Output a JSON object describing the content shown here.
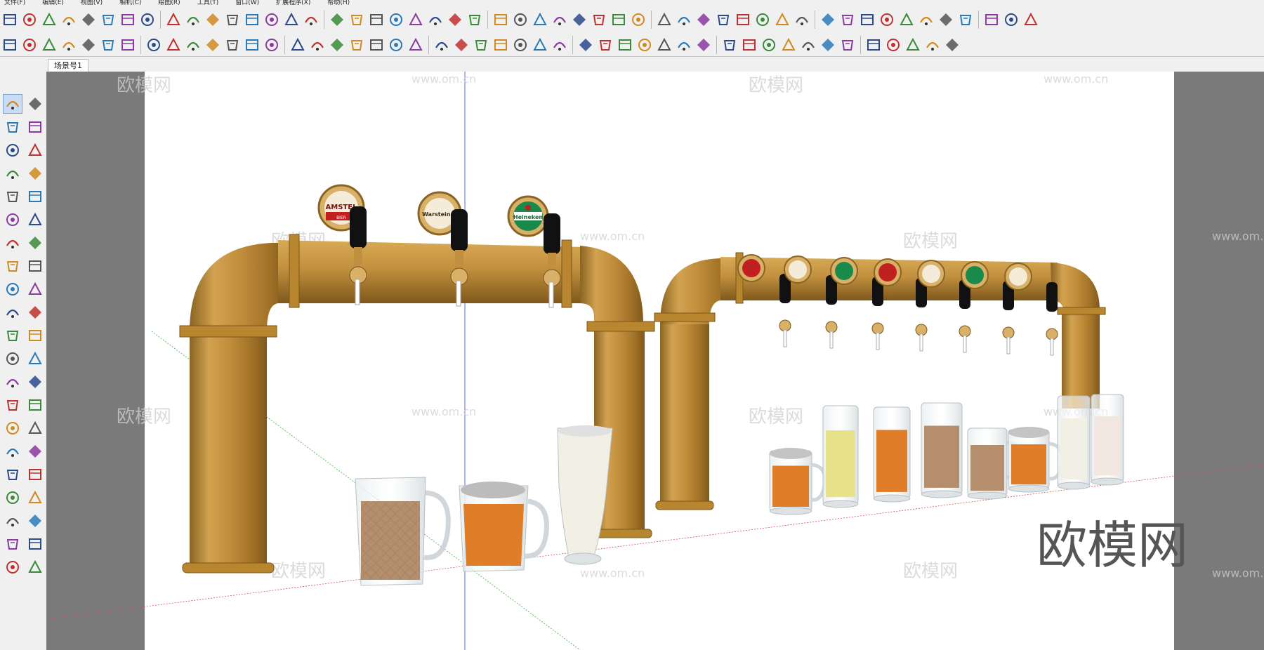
{
  "app": {
    "menu": [
      "文件(F)",
      "编辑(E)",
      "视图(V)",
      "相机(C)",
      "绘图(R)",
      "工具(T)",
      "窗口(W)",
      "扩展程序(X)",
      "帮助(H)"
    ]
  },
  "scene_tab": {
    "label": "场景号1"
  },
  "watermark": {
    "brand": "欧模网",
    "url": "www.om.cn"
  },
  "tap_labels": {
    "amstel": "AMSTEL",
    "amstel_sub": "BIER",
    "warsteiner": "Warsteiner",
    "heineken": "Heineken"
  },
  "toolbar_top_icons": [
    "component-icon",
    "sandbox-icon",
    "circle-icon",
    "protractor-icon",
    "tape-icon",
    "explode-icon",
    "arc-icon",
    "disk-icon",
    "vray-icon",
    "palette-icon",
    "teapot-icon",
    "teapot2-icon",
    "teapot3-icon",
    "refresh-icon",
    "render-icon",
    "frame-icon",
    "window-icon",
    "window2-icon",
    "image-icon",
    "lock-icon",
    "stairs-icon",
    "ladder-icon",
    "rail-icon",
    "chart-icon",
    "tree-icon",
    "line-icon",
    "branch-icon",
    "branch2-icon",
    "arch-icon",
    "curve-icon",
    "spline-icon",
    "slab-icon",
    "pen-icon",
    "diamond-icon",
    "diamond2-icon",
    "cube-icon",
    "spline2-icon",
    "cap-icon",
    "chain-icon",
    "wave-icon",
    "spiral-icon",
    "mirror-icon",
    "fence-icon",
    "column-icon",
    "triangle-icon",
    "dots-icon",
    "panel-icon",
    "pen2-icon",
    "brush-icon",
    "plugin-icon",
    "plugin2-icon"
  ],
  "toolbar_bottom_icons": [
    "package-icon",
    "book-icon",
    "house-icon",
    "house2-icon",
    "house3-icon",
    "zoom-icon",
    "select-icon",
    "eraser-icon",
    "pencil-icon",
    "arc-tool-icon",
    "rectangle-icon",
    "push-pull-icon",
    "follow-me-icon",
    "move-icon",
    "rotate-icon",
    "scale-icon",
    "tape-measure-icon",
    "text-icon",
    "paint-icon",
    "orbit-icon",
    "pan-icon",
    "zoom2-icon",
    "zoom-extents-icon",
    "layer-icon",
    "layers-icon",
    "layers2-icon",
    "layers3-icon",
    "user-icon",
    "section-icon",
    "section2-icon",
    "cube-view-icon",
    "iso-icon",
    "top-icon",
    "front-icon",
    "side-icon",
    "back-icon",
    "solid-icon",
    "walk-icon",
    "box-icon",
    "box2-icon",
    "grass-icon",
    "texture-icon",
    "grid-icon",
    "shape-icon",
    "table-icon",
    "copy-icon",
    "info-icon"
  ],
  "left_icons": [
    "select-arrow-icon",
    "orbit-ring-icon",
    "paint-bucket-icon",
    "eraser-tool-icon",
    "component-tool-icon",
    "dimension-icon",
    "line-tool-icon",
    "freehand-icon",
    "rectangle-tool-icon",
    "rotated-rect-icon",
    "circle-tool-icon",
    "polygon-icon",
    "arc-tool2-icon",
    "arc3-icon",
    "pie-icon",
    "arc4-icon",
    "move-tool-icon",
    "push-pull-tool-icon",
    "rotate-tool-icon",
    "follow-me-tool-icon",
    "scale-tool-icon",
    "offset-icon",
    "tape-tool-icon",
    "dim-tool-icon",
    "protractor-tool-icon",
    "text-tool-icon",
    "axes-icon",
    "3d-text-icon",
    "orbit-tool-icon",
    "pan-tool-icon",
    "zoom-tool-icon",
    "zoom-window-icon",
    "zoom-extents-tool-icon",
    "previous-view-icon",
    "position-camera-icon",
    "look-around-icon",
    "walk-tool-icon",
    "section-plane-icon",
    "sandbox1-icon",
    "sandbox2-icon",
    "sandbox3-icon",
    "sandbox4-icon"
  ]
}
